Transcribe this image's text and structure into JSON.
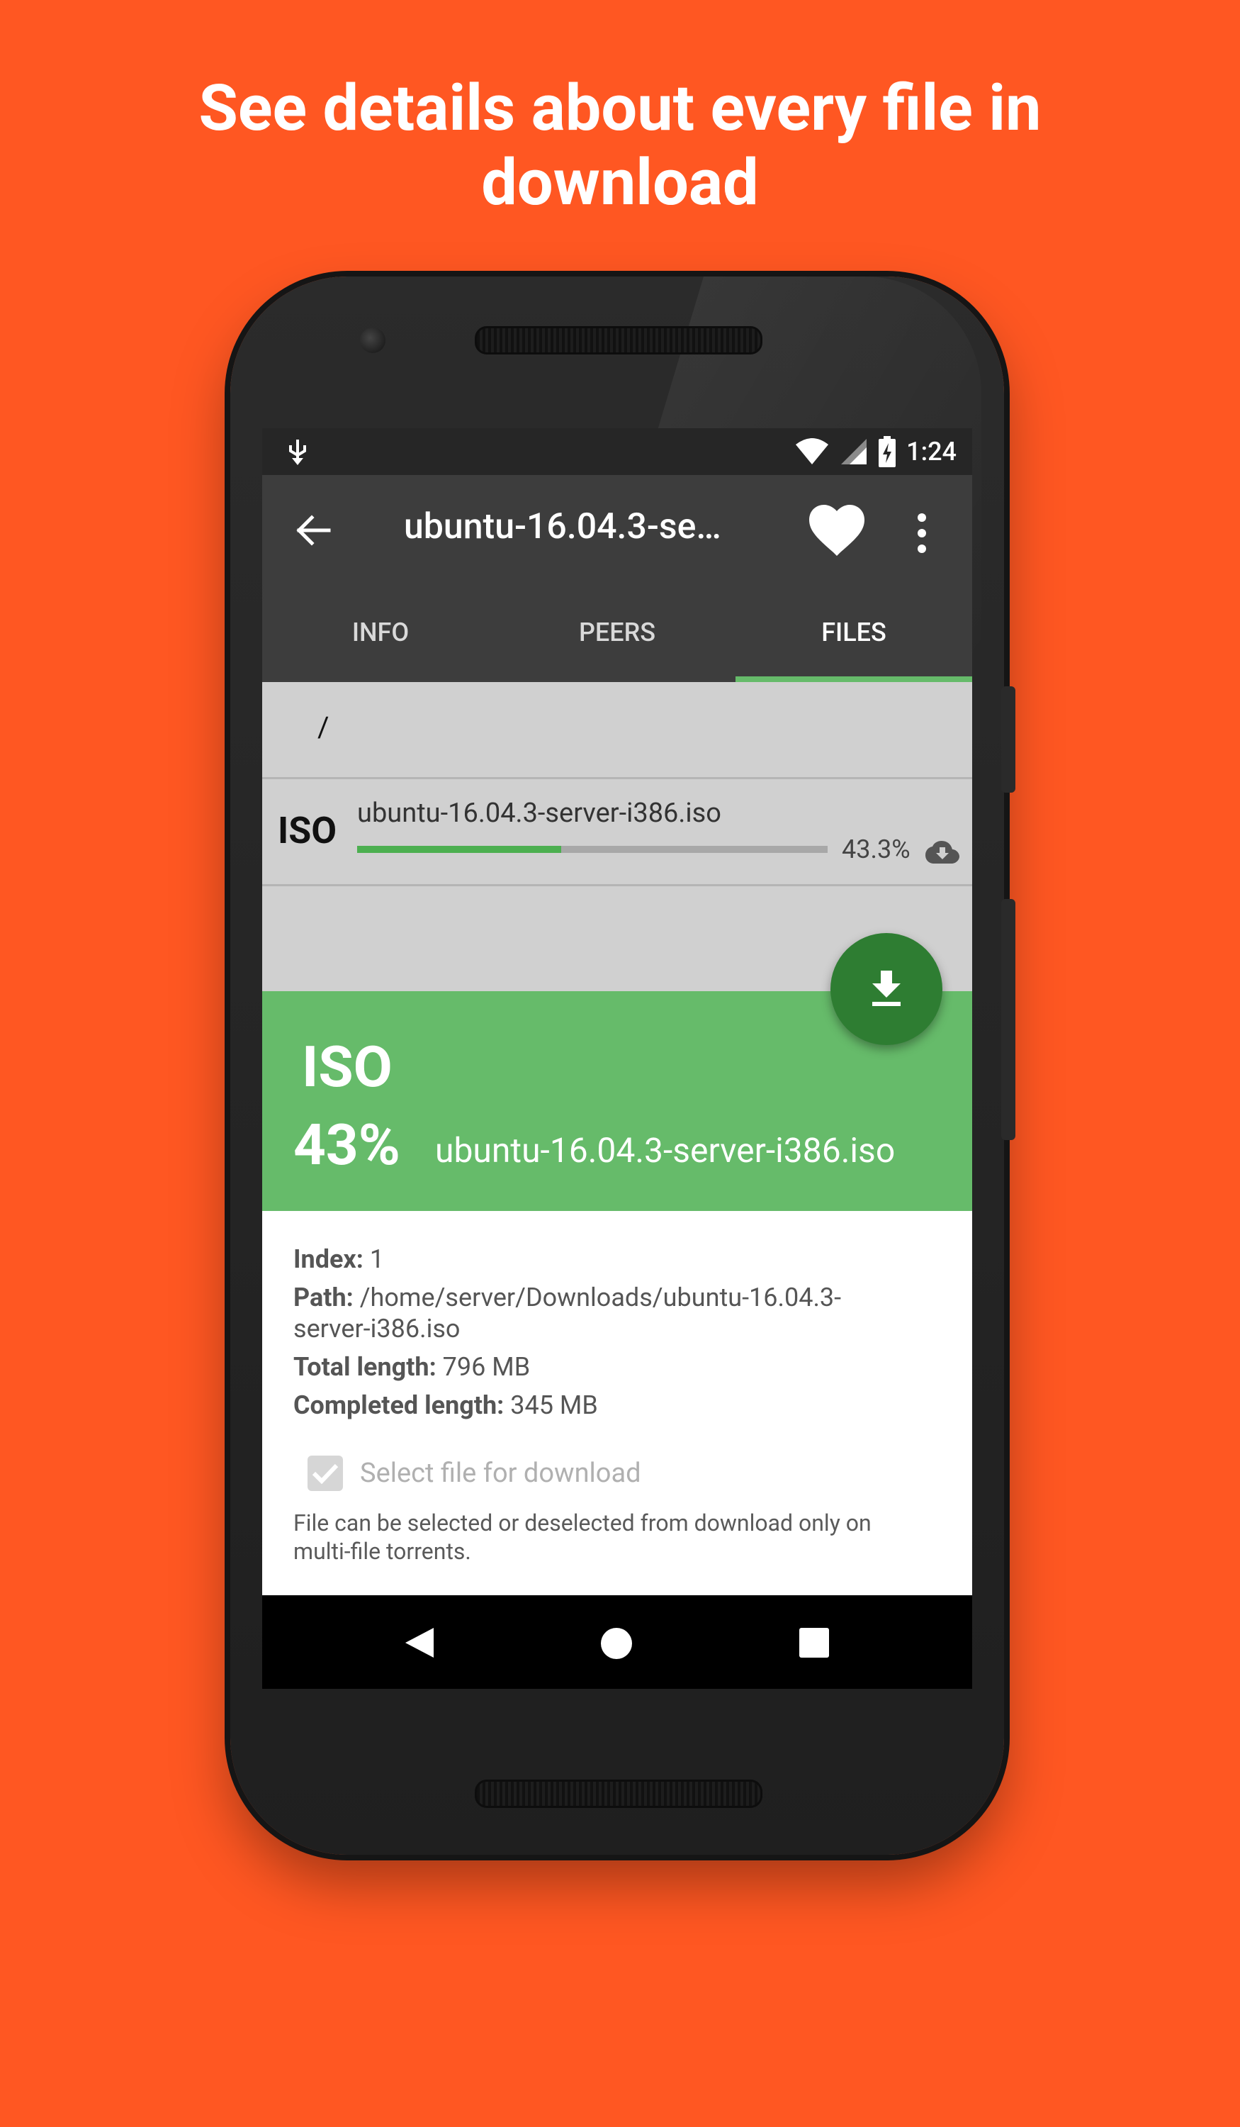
{
  "promo": {
    "title_line1": "See details about every file in",
    "title_line2": "download"
  },
  "status_bar": {
    "time": "1:24",
    "icons": [
      "usb-debug-icon",
      "wifi-icon",
      "signal-icon",
      "battery-charging-icon"
    ]
  },
  "appbar": {
    "title": "ubuntu-16.04.3-se…",
    "back_icon": "arrow-left-icon",
    "favorite_icon": "heart-icon",
    "more_icon": "more-vert-icon"
  },
  "tabs": [
    {
      "label": "INFO",
      "active": false
    },
    {
      "label": "PEERS",
      "active": false
    },
    {
      "label": "FILES",
      "active": true
    }
  ],
  "files": {
    "path": "/",
    "items": [
      {
        "ext": "ISO",
        "name": "ubuntu-16.04.3-server-i386.iso",
        "progress": 0.433,
        "percent_label": "43.3%",
        "status_icon": "cloud-download-icon"
      }
    ]
  },
  "fab": {
    "icon": "download-icon"
  },
  "detail_sheet": {
    "ext": "ISO",
    "percent": "43%",
    "name": "ubuntu-16.04.3-server-i386.iso",
    "index_label": "Index:",
    "index_value": "1",
    "path_label": "Path:",
    "path_value": "/home/server/Downloads/ubuntu-16.04.3-",
    "path_value_cont": "server-i386.iso",
    "total_label": "Total length:",
    "total_value": "796 MB",
    "completed_label": "Completed length:",
    "completed_value": "345 MB",
    "checkbox_label": "Select file for download",
    "checkbox_checked": true,
    "note_line1": "File can be selected or deselected from download only on",
    "note_line2": "multi-file torrents."
  },
  "colors": {
    "background": "#ff5722",
    "appbar": "#3d3d3d",
    "accent_green": "#66bb6a",
    "fab_green": "#2e7d32",
    "progress_green": "#4caf50"
  },
  "navbar": {
    "icons": [
      "back-triangle-icon",
      "home-circle-icon",
      "recents-square-icon"
    ]
  }
}
